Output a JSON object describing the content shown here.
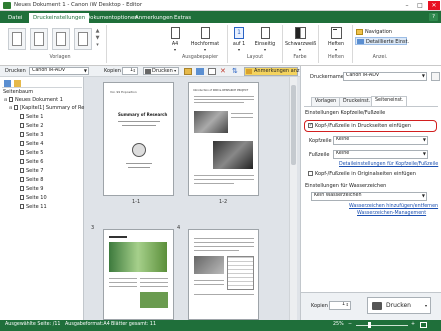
{
  "window": {
    "title": "Neues Dokument 1 - Canon iW Desktop - Editor",
    "minimize": "–",
    "maximize": "□",
    "close": "✕"
  },
  "tabs": [
    {
      "label": "Datei"
    },
    {
      "label": "Druckeinstellungen"
    },
    {
      "label": "Dokumentoptionen"
    },
    {
      "label": "Anmerkungen"
    },
    {
      "label": "Extras"
    }
  ],
  "help_label": "?",
  "ribbon": {
    "groups": {
      "vorlagen": "Vorlagen",
      "ausgabepapier": "Ausgabepapier",
      "layout": "Layout",
      "farbe": "Farbe",
      "heften": "Heften",
      "anzei": "Anzei."
    },
    "buttons": {
      "a4": "A4",
      "hochformat": "Hochformat",
      "page_count": "1",
      "auf1": "auf 1",
      "einseitig": "Einseitig",
      "schwarzweiss": "Schwarzweiß",
      "heften": "Heften",
      "navigation": "Navigation",
      "detaillierte_einst": "Detaillierte Einst."
    }
  },
  "toolbar": {
    "drucken_label": "Drucken",
    "printer": "Canon iR-ADV",
    "kopien_label": "Kopien",
    "kopien_value": "1",
    "drucken_button": "Drucken",
    "anmerkungen_button": "Anmerkungen anz."
  },
  "leftpane": {
    "title": "Seitenbaum",
    "items": [
      {
        "label": "Neues Dokument 1"
      },
      {
        "label": "[Kapitel1] Summary of Re"
      },
      {
        "label": "Seite 1"
      },
      {
        "label": "Seite 2"
      },
      {
        "label": "Seite 3"
      },
      {
        "label": "Seite 4"
      },
      {
        "label": "Seite 5"
      },
      {
        "label": "Seite 6"
      },
      {
        "label": "Seite 7"
      },
      {
        "label": "Seite 8"
      },
      {
        "label": "Seite 9"
      },
      {
        "label": "Seite 10"
      },
      {
        "label": "Seite 11"
      }
    ]
  },
  "preview": {
    "pages": [
      {
        "label": "1-1",
        "heading": "Summary of Research",
        "header": "Vol. 99 Exposition"
      },
      {
        "label": "1-2",
        "header": "Introduction of RND & RESEARCH PROJECT"
      },
      {
        "label": "3"
      },
      {
        "label": "4"
      }
    ]
  },
  "rightpane": {
    "druckername_label": "Druckername:",
    "druckername_value": "Canon iR-ADV",
    "rtabs": [
      {
        "label": "Vorlagen"
      },
      {
        "label": "Druckeinst."
      },
      {
        "label": "Seiteneinst."
      }
    ],
    "section_kopf": "Einstellungen Kopfzeile/Fußzeile",
    "checkbox_print": "Kopf-/Fußzeile in Druckseiten einfügen",
    "kopfzeile_label": "Kopfzeile",
    "kopfzeile_value": "Keine",
    "fusszeile_label": "Fußzeile",
    "fusszeile_value": "Keine",
    "link_detail": "Detaileinstellungen für Kopfzeile/Fußzeile",
    "checkbox_original": "Kopf-/Fußzeile in Originalseiten einfügen",
    "section_wasser": "Einstellungen für Wasserzeichen",
    "wasser_value": "Kein Wasserzeichen",
    "link_add": "Wasserzeichen hinzufügen/entfernen",
    "link_manage": "Wasserzeichen-Management",
    "kopien_label": "Kopien",
    "kopien_value": "1",
    "drucken_button": "Drucken"
  },
  "statusbar": {
    "selected": "Ausgewählte Seite: /11",
    "format": "Ausgabeformat:A4",
    "sheets": "Blätter gesamt: 11",
    "zoom": "25%"
  },
  "colors": {
    "accent_green": "#1f6f3a",
    "highlight_red": "#d21f1f",
    "link_blue": "#1a4fb0"
  }
}
